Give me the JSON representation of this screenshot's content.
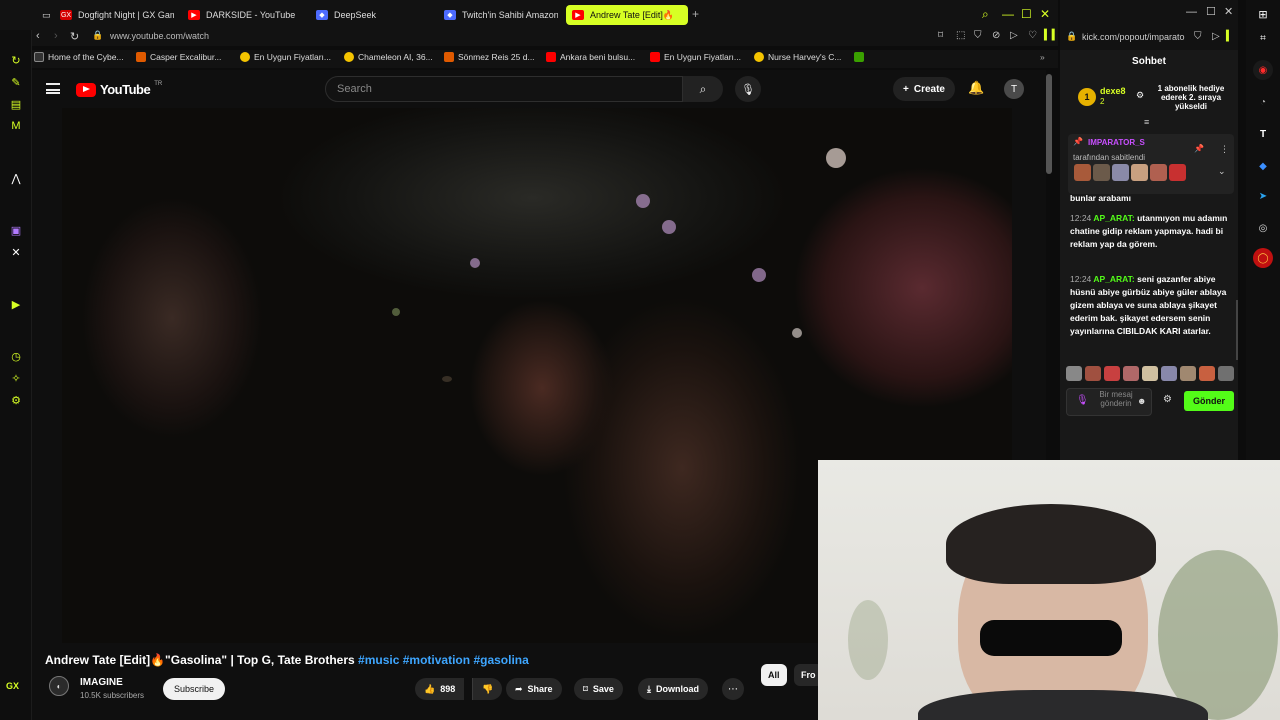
{
  "browser": {
    "tabs": [
      {
        "label": "Dogfight Night | GX Gam",
        "fav_color": "#d40000",
        "fav_text": "GX"
      },
      {
        "label": "DARKSIDE - YouTube",
        "fav_color": "#ff0000",
        "fav_text": "▶"
      },
      {
        "label": "DeepSeek",
        "fav_color": "#4d6bfe",
        "fav_text": "◆"
      },
      {
        "label": "Twitch'in Sahibi Amazon",
        "fav_color": "#4d6bfe",
        "fav_text": "◆"
      },
      {
        "label": "Andrew Tate [Edit]🔥",
        "fav_color": "#ff0000",
        "fav_text": "▶"
      }
    ],
    "new_tab": "+",
    "url": "www.youtube.com/watch",
    "bookmarks": [
      {
        "label": "Home of the Cybe...",
        "color": "#333333"
      },
      {
        "label": "Casper Excalibur...",
        "color": "#e05a00"
      },
      {
        "label": "En Uygun Fiyatları...",
        "color": "#f5c400"
      },
      {
        "label": "Chameleon AI, 36...",
        "color": "#e05a00"
      },
      {
        "label": "Sönmez Reis 25 d...",
        "color": "#ff0000"
      },
      {
        "label": "Ankara beni bulsu...",
        "color": "#ff0000"
      },
      {
        "label": "En Uygun Fiyatları...",
        "color": "#f5c400"
      },
      {
        "label": "Nurse Harvey's C...",
        "color": "#3aa000"
      }
    ],
    "gx_label": "GX",
    "accent": "#d7ff24"
  },
  "youtube": {
    "logo_text": "YouTube",
    "country": "TR",
    "search_placeholder": "Search",
    "create_label": "Create",
    "avatar_letter": "T",
    "video": {
      "title_main": "Andrew Tate [Edit]🔥\"Gasolina\" | Top G, Tate Brothers",
      "tags": [
        "#music",
        "#motivation",
        "#gasolina"
      ]
    },
    "channel": {
      "name": "IMAGINE",
      "subs": "10.5K subscribers",
      "subscribe_label": "Subscribe"
    },
    "actions": {
      "likes": "898",
      "share": "Share",
      "save": "Save",
      "download": "Download"
    },
    "chips": [
      "All",
      "Fro"
    ]
  },
  "kick": {
    "url": "kick.com/popout/imparato",
    "chat_title": "Sohbet",
    "gift": {
      "badge": "1",
      "user": "dexe8",
      "count": "2",
      "text": "1 abonelik hediye ederek 2. sıraya yükseldi"
    },
    "pinned": {
      "user": "IMPARATOR_S",
      "by": "tarafından sabitlendi"
    },
    "messages": [
      {
        "time": "",
        "user": "",
        "text": "bunlar arabamı"
      },
      {
        "time": "12:24",
        "user": "AP_ARAT:",
        "text": "utanmıyon mu adamın chatine gidip reklam yapmaya. hadi bi reklam yap da görem."
      },
      {
        "time": "12:24",
        "user": "AP_ARAT:",
        "text": "seni gazanfer abiye hüsnü abiye gürbüz abiye güler ablaya gizem ablaya ve suna ablaya şikayet ederim bak. şikayet edersem senin yayınlarına CIBILDAK KARI atarlar."
      }
    ],
    "input_placeholder": "Bir mesaj gönderin",
    "send_label": "Gönder",
    "accent": "#53fc18"
  }
}
